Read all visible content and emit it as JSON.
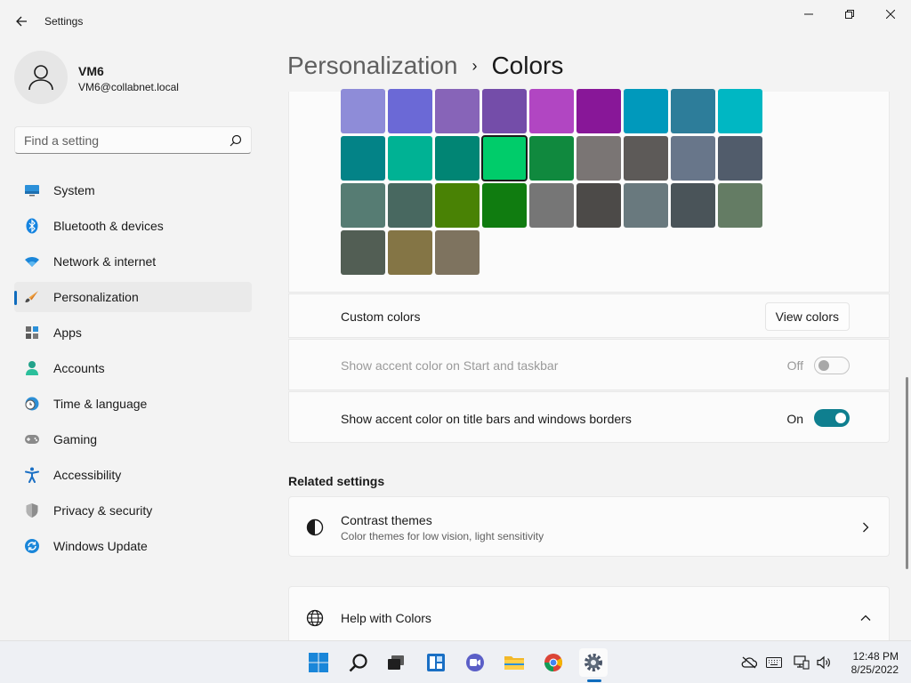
{
  "window": {
    "title": "Settings",
    "back_icon": "arrow-left-icon",
    "controls": [
      "minimize-icon",
      "maximize-icon",
      "close-icon"
    ]
  },
  "profile": {
    "name": "VM6",
    "email": "VM6@collabnet.local",
    "avatar_icon": "person-icon"
  },
  "search": {
    "placeholder": "Find a setting",
    "icon": "search-icon"
  },
  "sidebar": {
    "items": [
      {
        "label": "System",
        "icon": "monitor-icon",
        "active": false
      },
      {
        "label": "Bluetooth & devices",
        "icon": "bluetooth-icon",
        "active": false
      },
      {
        "label": "Network & internet",
        "icon": "wifi-icon",
        "active": false
      },
      {
        "label": "Personalization",
        "icon": "brush-icon",
        "active": true
      },
      {
        "label": "Apps",
        "icon": "apps-icon",
        "active": false
      },
      {
        "label": "Accounts",
        "icon": "account-icon",
        "active": false
      },
      {
        "label": "Time & language",
        "icon": "clock-globe-icon",
        "active": false
      },
      {
        "label": "Gaming",
        "icon": "gamepad-icon",
        "active": false
      },
      {
        "label": "Accessibility",
        "icon": "accessibility-icon",
        "active": false
      },
      {
        "label": "Privacy & security",
        "icon": "shield-icon",
        "active": false
      },
      {
        "label": "Windows Update",
        "icon": "update-icon",
        "active": false
      }
    ]
  },
  "breadcrumb": {
    "parent": "Personalization",
    "separator": "›",
    "current": "Colors"
  },
  "accent_colors": {
    "rows": [
      [
        "#8e8cd8",
        "#6b69d6",
        "#8764b8",
        "#744da9",
        "#b146c2",
        "#881798",
        "#0099bc",
        "#2d7d9a",
        "#00b7c3"
      ],
      [
        "#038387",
        "#00b294",
        "#018574",
        "#00cc6a",
        "#10893e",
        "#7a7574",
        "#5d5a58",
        "#68768a",
        "#515c6b"
      ],
      [
        "#567c73",
        "#486860",
        "#498205",
        "#107c10",
        "#767676",
        "#4c4a48",
        "#69797e",
        "#4a5459",
        "#647c64"
      ],
      [
        "#525e54",
        "#847545",
        "#7e735f"
      ]
    ],
    "selected": "#00cc6a"
  },
  "custom_colors": {
    "label": "Custom colors",
    "button": "View colors"
  },
  "accent_start_taskbar": {
    "label": "Show accent color on Start and taskbar",
    "state": "Off",
    "enabled": false
  },
  "accent_title_bars": {
    "label": "Show accent color on title bars and windows borders",
    "state": "On",
    "enabled": true
  },
  "related": {
    "title": "Related settings",
    "contrast": {
      "title": "Contrast themes",
      "subtitle": "Color themes for low vision, light sensitivity",
      "icon": "contrast-icon"
    },
    "help": {
      "title": "Help with Colors",
      "icon": "globe-icon"
    }
  },
  "taskbar": {
    "apps": [
      "windows-start-icon",
      "search-icon",
      "task-view-icon",
      "widgets-icon",
      "teams-chat-icon",
      "file-explorer-icon",
      "chrome-icon",
      "settings-gear-icon"
    ],
    "active_app": "settings-gear-icon",
    "tray": [
      "cloud-offline-icon",
      "keyboard-icon",
      "network-icon",
      "volume-icon"
    ],
    "time": "12:48 PM",
    "date": "8/25/2022"
  },
  "colors": {
    "accent": "#0f6cbd",
    "toggle_on": "#0f7f8f"
  }
}
